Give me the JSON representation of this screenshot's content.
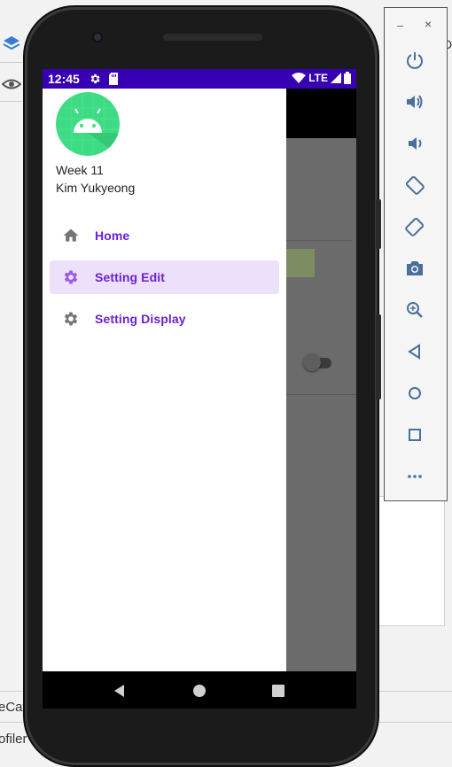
{
  "ide": {
    "bottom_text_1": "eCat",
    "bottom_text_2": "ofiler",
    "right_edge_char": "D"
  },
  "statusbar": {
    "time": "12:45",
    "network": "LTE",
    "color": "#3700b3"
  },
  "drawer": {
    "header_title": "Week 11",
    "header_subtitle": "Kim Yukyeong",
    "avatar_icon": "android-logo-icon",
    "items": [
      {
        "label": "Home",
        "icon": "home-icon",
        "active": false
      },
      {
        "label": "Setting Edit",
        "icon": "gear-icon",
        "active": true
      },
      {
        "label": "Setting Display",
        "icon": "gear-icon",
        "active": false
      }
    ],
    "accent_color": "#6a1fd6",
    "active_bg": "#ece0fb"
  },
  "emulator_controls": {
    "minimize_label": "–",
    "close_label": "×",
    "buttons": [
      "power-icon",
      "volume-up-icon",
      "volume-down-icon",
      "rotate-left-icon",
      "rotate-right-icon",
      "screenshot-icon",
      "zoom-icon",
      "back-icon",
      "home-circle-icon",
      "overview-icon",
      "more-icon"
    ]
  }
}
